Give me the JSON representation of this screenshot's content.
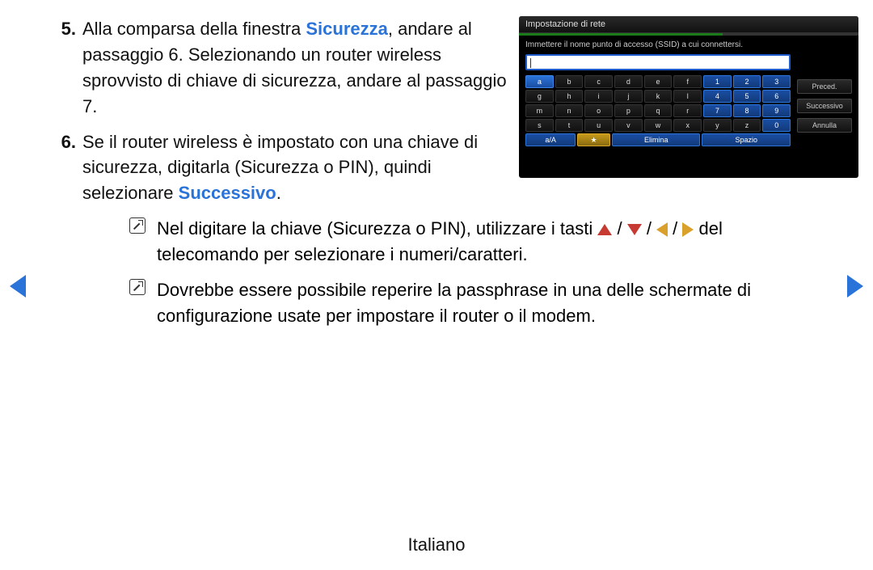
{
  "steps": {
    "s5": {
      "num": "5.",
      "pre": "Alla comparsa della finestra ",
      "hl": "Sicurezza",
      "post": ", andare al passaggio 6. Selezionando un router wireless sprovvisto di chiave di sicurezza, andare al passaggio 7."
    },
    "s6": {
      "num": "6.",
      "pre": "Se il router wireless è impostato con una chiave di sicurezza, digitarla (Sicurezza o PIN), quindi selezionare ",
      "hl": "Successivo",
      "post": "."
    }
  },
  "notes": {
    "n1": {
      "pre": "Nel digitare la chiave (Sicurezza o PIN), utilizzare i tasti ",
      "sep": " / ",
      "post": " del telecomando per selezionare i numeri/caratteri."
    },
    "n2": "Dovrebbe essere possibile reperire la passphrase in una delle schermate di configurazione usate per impostare il router o il modem."
  },
  "footer": "Italiano",
  "tv": {
    "title": "Impostazione di rete",
    "prompt": "Immettere il nome punto di accesso (SSID) a cui connettersi.",
    "rows": [
      [
        "a",
        "b",
        "c",
        "d",
        "e",
        "f",
        "1",
        "2",
        "3"
      ],
      [
        "g",
        "h",
        "i",
        "j",
        "k",
        "l",
        "4",
        "5",
        "6"
      ],
      [
        "m",
        "n",
        "o",
        "p",
        "q",
        "r",
        "7",
        "8",
        "9"
      ],
      [
        "s",
        "t",
        "u",
        "v",
        "w",
        "x",
        "y",
        "z",
        "0"
      ]
    ],
    "bottom": {
      "shift": "a/A",
      "star": "★",
      "del": "Elimina",
      "space": "Spazio"
    },
    "side": {
      "prev": "Preced.",
      "next": "Successivo",
      "cancel": "Annulla"
    }
  }
}
